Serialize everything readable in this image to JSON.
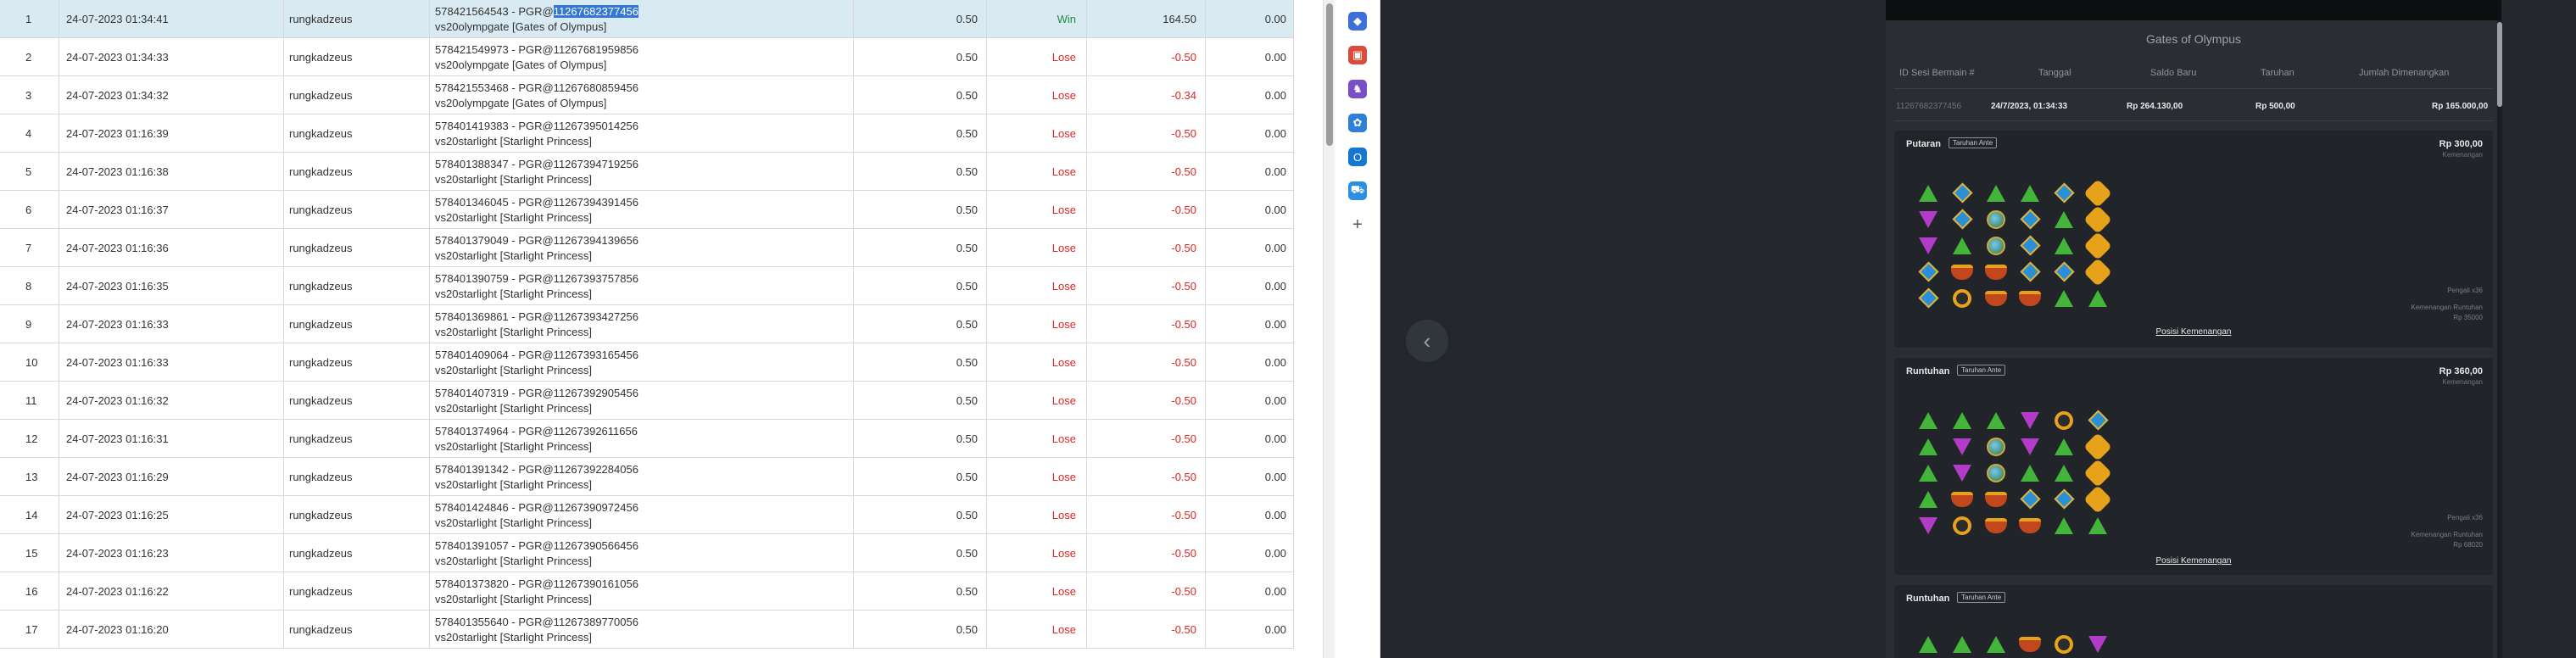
{
  "table": {
    "rows": [
      {
        "idx": "1",
        "date": "24-07-2023 01:34:41",
        "user": "rungkadzeus",
        "desc_pre": "578421564543 - PGR@",
        "desc_sel": "11267682377456",
        "game": "vs20olympgate [Gates of Olympus]",
        "bet": "0.50",
        "result": "Win",
        "amount": "164.50",
        "balance": "0.00"
      },
      {
        "idx": "2",
        "date": "24-07-2023 01:34:33",
        "user": "rungkadzeus",
        "desc_pre": "578421549973 - PGR@11267681959856",
        "desc_sel": "",
        "game": "vs20olympgate [Gates of Olympus]",
        "bet": "0.50",
        "result": "Lose",
        "amount": "-0.50",
        "balance": "0.00"
      },
      {
        "idx": "3",
        "date": "24-07-2023 01:34:32",
        "user": "rungkadzeus",
        "desc_pre": "578421553468 - PGR@11267680859456",
        "desc_sel": "",
        "game": "vs20olympgate [Gates of Olympus]",
        "bet": "0.50",
        "result": "Lose",
        "amount": "-0.34",
        "balance": "0.00"
      },
      {
        "idx": "4",
        "date": "24-07-2023 01:16:39",
        "user": "rungkadzeus",
        "desc_pre": "578401419383 - PGR@11267395014256",
        "desc_sel": "",
        "game": "vs20starlight [Starlight Princess]",
        "bet": "0.50",
        "result": "Lose",
        "amount": "-0.50",
        "balance": "0.00"
      },
      {
        "idx": "5",
        "date": "24-07-2023 01:16:38",
        "user": "rungkadzeus",
        "desc_pre": "578401388347 - PGR@11267394719256",
        "desc_sel": "",
        "game": "vs20starlight [Starlight Princess]",
        "bet": "0.50",
        "result": "Lose",
        "amount": "-0.50",
        "balance": "0.00"
      },
      {
        "idx": "6",
        "date": "24-07-2023 01:16:37",
        "user": "rungkadzeus",
        "desc_pre": "578401346045 - PGR@11267394391456",
        "desc_sel": "",
        "game": "vs20starlight [Starlight Princess]",
        "bet": "0.50",
        "result": "Lose",
        "amount": "-0.50",
        "balance": "0.00"
      },
      {
        "idx": "7",
        "date": "24-07-2023 01:16:36",
        "user": "rungkadzeus",
        "desc_pre": "578401379049 - PGR@11267394139656",
        "desc_sel": "",
        "game": "vs20starlight [Starlight Princess]",
        "bet": "0.50",
        "result": "Lose",
        "amount": "-0.50",
        "balance": "0.00"
      },
      {
        "idx": "8",
        "date": "24-07-2023 01:16:35",
        "user": "rungkadzeus",
        "desc_pre": "578401390759 - PGR@11267393757856",
        "desc_sel": "",
        "game": "vs20starlight [Starlight Princess]",
        "bet": "0.50",
        "result": "Lose",
        "amount": "-0.50",
        "balance": "0.00"
      },
      {
        "idx": "9",
        "date": "24-07-2023 01:16:33",
        "user": "rungkadzeus",
        "desc_pre": "578401369861 - PGR@11267393427256",
        "desc_sel": "",
        "game": "vs20starlight [Starlight Princess]",
        "bet": "0.50",
        "result": "Lose",
        "amount": "-0.50",
        "balance": "0.00"
      },
      {
        "idx": "10",
        "date": "24-07-2023 01:16:33",
        "user": "rungkadzeus",
        "desc_pre": "578401409064 - PGR@11267393165456",
        "desc_sel": "",
        "game": "vs20starlight [Starlight Princess]",
        "bet": "0.50",
        "result": "Lose",
        "amount": "-0.50",
        "balance": "0.00"
      },
      {
        "idx": "11",
        "date": "24-07-2023 01:16:32",
        "user": "rungkadzeus",
        "desc_pre": "578401407319 - PGR@11267392905456",
        "desc_sel": "",
        "game": "vs20starlight [Starlight Princess]",
        "bet": "0.50",
        "result": "Lose",
        "amount": "-0.50",
        "balance": "0.00"
      },
      {
        "idx": "12",
        "date": "24-07-2023 01:16:31",
        "user": "rungkadzeus",
        "desc_pre": "578401374964 - PGR@11267392611656",
        "desc_sel": "",
        "game": "vs20starlight [Starlight Princess]",
        "bet": "0.50",
        "result": "Lose",
        "amount": "-0.50",
        "balance": "0.00"
      },
      {
        "idx": "13",
        "date": "24-07-2023 01:16:29",
        "user": "rungkadzeus",
        "desc_pre": "578401391342 - PGR@11267392284056",
        "desc_sel": "",
        "game": "vs20starlight [Starlight Princess]",
        "bet": "0.50",
        "result": "Lose",
        "amount": "-0.50",
        "balance": "0.00"
      },
      {
        "idx": "14",
        "date": "24-07-2023 01:16:25",
        "user": "rungkadzeus",
        "desc_pre": "578401424846 - PGR@11267390972456",
        "desc_sel": "",
        "game": "vs20starlight [Starlight Princess]",
        "bet": "0.50",
        "result": "Lose",
        "amount": "-0.50",
        "balance": "0.00"
      },
      {
        "idx": "15",
        "date": "24-07-2023 01:16:23",
        "user": "rungkadzeus",
        "desc_pre": "578401391057 - PGR@11267390566456",
        "desc_sel": "",
        "game": "vs20starlight [Starlight Princess]",
        "bet": "0.50",
        "result": "Lose",
        "amount": "-0.50",
        "balance": "0.00"
      },
      {
        "idx": "16",
        "date": "24-07-2023 01:16:22",
        "user": "rungkadzeus",
        "desc_pre": "578401373820 - PGR@11267390161056",
        "desc_sel": "",
        "game": "vs20starlight [Starlight Princess]",
        "bet": "0.50",
        "result": "Lose",
        "amount": "-0.50",
        "balance": "0.00"
      },
      {
        "idx": "17",
        "date": "24-07-2023 01:16:20",
        "user": "rungkadzeus",
        "desc_pre": "578401355640 - PGR@11267389770056",
        "desc_sel": "",
        "game": "vs20starlight [Starlight Princess]",
        "bet": "0.50",
        "result": "Lose",
        "amount": "-0.50",
        "balance": "0.00"
      }
    ]
  },
  "sidebar": {
    "icons": [
      {
        "name": "tag-icon",
        "color": "#3d6fd8",
        "glyph": "◆"
      },
      {
        "name": "toolbox-icon",
        "color": "#d94b3a",
        "glyph": "▣"
      },
      {
        "name": "chess-icon",
        "color": "#7a4ec4",
        "glyph": "♞"
      },
      {
        "name": "copilot-icon",
        "color": "#2d7fd8",
        "glyph": "✿"
      },
      {
        "name": "outlook-icon",
        "color": "#1677d2",
        "glyph": "O"
      },
      {
        "name": "shopping-icon",
        "color": "#2c8fe0",
        "glyph": "⛟"
      },
      {
        "name": "add-icon",
        "color": "#ffffff",
        "glyph": "+"
      }
    ]
  },
  "panel": {
    "title": "Gates of Olympus",
    "headers": [
      "ID Sesi Bermain #",
      "Tanggal",
      "Saldo Baru",
      "Taruhan",
      "Jumlah Dimenangkan"
    ],
    "values": [
      "11267682377456",
      "24/7/2023, 01:34:33",
      "Rp 264.130,00",
      "Rp 500,00",
      "Rp 165.000,00"
    ],
    "cards": [
      {
        "title": "Putaran",
        "badge": "Taruhan Ante",
        "amount": "Rp 300,00",
        "sub": "Kemenangan",
        "info1": "Pengali x36",
        "info2": "Kemenangan Runtuhan",
        "info3": "Rp 35000",
        "link": "Posisi Kemenangan"
      },
      {
        "title": "Runtuhan",
        "badge": "Taruhan Ante",
        "amount": "Rp 360,00",
        "sub": "Kemenangan",
        "info1": "Pengali x36",
        "info2": "Kemenangan Runtuhan",
        "info3": "Rp 68020",
        "link": "Posisi Kemenangan"
      },
      {
        "title": "Runtuhan",
        "badge": "Taruhan Ante",
        "amount": "",
        "sub": "",
        "info1": "",
        "info2": "",
        "info3": "",
        "link": ""
      }
    ],
    "grids": [
      [
        "tri",
        "dia",
        "tri",
        "tri",
        "dia",
        "hex",
        "trip",
        "dia",
        "globe",
        "dia",
        "tri",
        "hex",
        "trip",
        "tri",
        "globe",
        "dia",
        "tri",
        "hex",
        "dia",
        "cup",
        "cup",
        "dia",
        "dia",
        "hex",
        "dia",
        "ring",
        "cup",
        "cup",
        "tri",
        "tri"
      ],
      [
        "tri",
        "tri",
        "tri",
        "trip",
        "ring",
        "dia",
        "tri",
        "trip",
        "globe",
        "trip",
        "tri",
        "hex",
        "tri",
        "trip",
        "globe",
        "tri",
        "tri",
        "hex",
        "tri",
        "cup",
        "cup",
        "dia",
        "dia",
        "hex",
        "trip",
        "ring",
        "cup",
        "cup",
        "tri",
        "tri"
      ],
      [
        "tri",
        "tri",
        "tri",
        "cup",
        "ring",
        "trip"
      ]
    ]
  }
}
